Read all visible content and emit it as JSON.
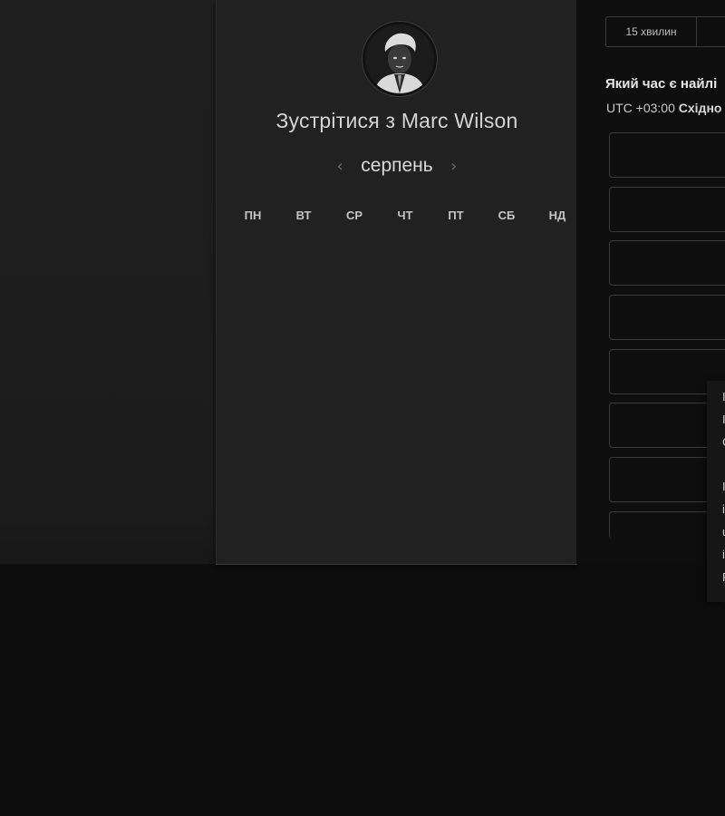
{
  "scheduler": {
    "host_prefix": "Зустрітися з",
    "host_name": "Marc Wilson",
    "month": "серпень",
    "weekdays": [
      "ПН",
      "ВТ",
      "СР",
      "ЧТ",
      "ПТ",
      "СБ",
      "НД"
    ],
    "prev_icon": "chevron-left-icon",
    "next_icon": "chevron-right-icon"
  },
  "right": {
    "duration_tabs": [
      "15 хвилин",
      ""
    ],
    "best_time_question": "Який час є найлі",
    "timezone_offset": "UTC +03:00",
    "timezone_name": "Східно"
  },
  "popup": {
    "clipped_chars": [
      "I",
      "I",
      "C",
      "I",
      "i",
      "u",
      "i",
      "F"
    ]
  },
  "colors": {
    "card_bg": "#212121",
    "page_bg": "#0c0c0c",
    "text_primary": "#d4d4d4"
  }
}
